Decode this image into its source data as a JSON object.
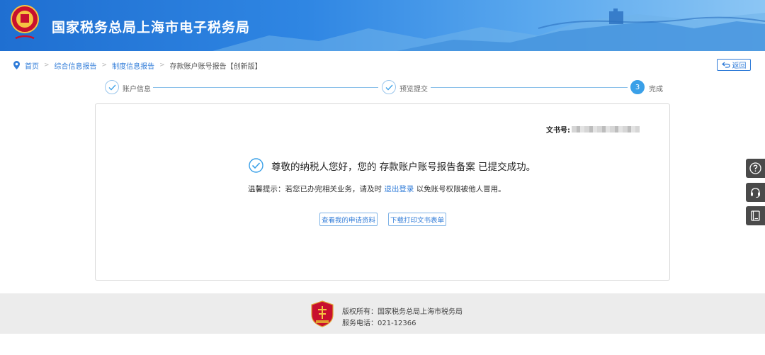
{
  "header": {
    "site_title": "国家税务总局上海市电子税务局",
    "logo_icon": "tax-emblem-icon"
  },
  "breadcrumb": {
    "items": [
      "首页",
      "综合信息报告",
      "制度信息报告",
      "存款账户账号报告【创新版】"
    ],
    "back_label": "返回"
  },
  "steps": [
    {
      "label": "账户信息",
      "status": "done"
    },
    {
      "label": "预览提交",
      "status": "done"
    },
    {
      "label": "完成",
      "number": "3",
      "status": "active"
    }
  ],
  "result": {
    "doc_no_label": "文书号:",
    "success_message": "尊敬的纳税人您好，您的 存款账户账号报告备案 已提交成功。",
    "tip_prefix": "温馨提示：若您已办完相关业务，请及时",
    "tip_link": "退出登录",
    "tip_suffix": "以免账号权限被他人冒用。",
    "view_button": "查看我的申请资料",
    "download_button": "下载打印文书表单"
  },
  "tools": [
    "help-icon",
    "customer-service-icon",
    "manual-icon"
  ],
  "footer": {
    "copyright": "版权所有：国家税务总局上海市税务局",
    "phone": "服务电话：021-12366"
  },
  "colors": {
    "accent": "#2f7bd8",
    "step_active": "#3aa0e8",
    "header_start": "#1f6fd1",
    "footer_bg": "#ececec"
  }
}
